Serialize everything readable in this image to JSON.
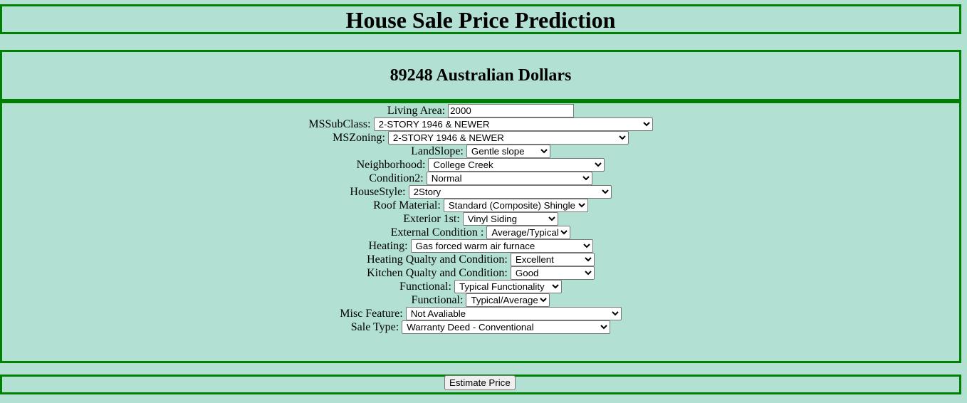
{
  "header": {
    "title": "House Sale Price Prediction"
  },
  "result": {
    "prediction": "89248 Australian Dollars"
  },
  "form": {
    "living_area": {
      "label": "Living Area:",
      "value": "2000"
    },
    "fields": [
      {
        "label": "MSSubClass:",
        "value": "2-STORY 1946 & NEWER"
      },
      {
        "label": "MSZoning:",
        "value": "2-STORY 1946 & NEWER"
      },
      {
        "label": "LandSlope:",
        "value": "Gentle slope"
      },
      {
        "label": "Neighborhood:",
        "value": "College Creek"
      },
      {
        "label": "Condition2:",
        "value": "Normal"
      },
      {
        "label": "HouseStyle:",
        "value": "2Story"
      },
      {
        "label": "Roof Material:",
        "value": "Standard (Composite) Shingle"
      },
      {
        "label": "Exterior 1st:",
        "value": "Vinyl Siding"
      },
      {
        "label": "External Condition :",
        "value": "Average/Typical"
      },
      {
        "label": "Heating:",
        "value": "Gas forced warm air furnace"
      },
      {
        "label": "Heating Qualty and Condition:",
        "value": "Excellent"
      },
      {
        "label": "Kitchen Qualty and Condition:",
        "value": "Good"
      },
      {
        "label": "Functional:",
        "value": "Typical Functionality"
      },
      {
        "label": "Functional:",
        "value": "Typical/Average"
      },
      {
        "label": "Misc Feature:",
        "value": "Not Avaliable"
      },
      {
        "label": "Sale Type:",
        "value": "Warranty Deed - Conventional"
      }
    ]
  },
  "actions": {
    "estimate_label": "Estimate Price"
  },
  "colors": {
    "background": "#b2e0d3",
    "border": "#008000"
  }
}
